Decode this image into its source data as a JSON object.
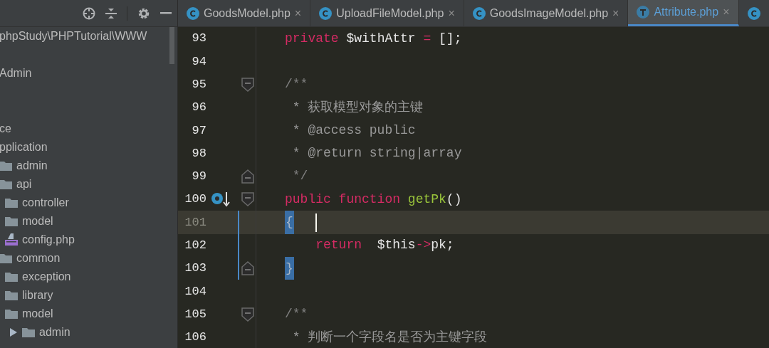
{
  "sidebar": {
    "tree": [
      {
        "name": "phpStudy\\PHPTutorial\\WWW"
      },
      {
        "name": "Admin"
      },
      {
        "name": "ce"
      },
      {
        "name": "pplication",
        "children": [
          {
            "name": "admin",
            "kind": "folder"
          },
          {
            "name": "api",
            "kind": "folder",
            "children": [
              {
                "name": "controller",
                "kind": "folder"
              },
              {
                "name": "model",
                "kind": "folder"
              },
              {
                "name": "config.php",
                "kind": "php"
              }
            ]
          },
          {
            "name": "common",
            "kind": "folder",
            "children": [
              {
                "name": "exception",
                "kind": "folder"
              },
              {
                "name": "library",
                "kind": "folder"
              },
              {
                "name": "model",
                "kind": "folder",
                "children": [
                  {
                    "name": "admin",
                    "kind": "folder",
                    "expanded": false
                  }
                ]
              }
            ]
          }
        ]
      }
    ]
  },
  "tabs": [
    {
      "label": "GoodsModel.php",
      "kind": "class",
      "close": "×",
      "selected": false
    },
    {
      "label": "UploadFileModel.php",
      "kind": "class",
      "close": "×",
      "selected": false
    },
    {
      "label": "GoodsImageModel.php",
      "kind": "class",
      "close": "×",
      "selected": false
    },
    {
      "label": "Attribute.php",
      "kind": "trait",
      "close": "×",
      "selected": true
    },
    {
      "kind": "class",
      "selected": false
    }
  ],
  "editor": {
    "lines": [
      {
        "number": "93",
        "current": false,
        "modified": false,
        "tokens": [
          {
            "kind": "keyword",
            "text": "private"
          },
          {
            "kind": "plain",
            "text": " $withAttr "
          },
          {
            "kind": "keyword",
            "text": "="
          },
          {
            "kind": "plain",
            "text": " [];"
          }
        ]
      },
      {
        "number": "94",
        "current": false,
        "modified": false
      },
      {
        "number": "95",
        "current": false,
        "modified": false,
        "fold": {
          "kind": "start"
        },
        "tokens": [
          {
            "kind": "comment",
            "text": "/**"
          }
        ]
      },
      {
        "number": "96",
        "current": false,
        "modified": false,
        "tokens": [
          {
            "kind": "doc",
            "text": " * 获取模型对象的主键"
          }
        ]
      },
      {
        "number": "97",
        "current": false,
        "modified": false,
        "tokens": [
          {
            "kind": "doc",
            "text": " * @access public"
          }
        ]
      },
      {
        "number": "98",
        "current": false,
        "modified": false,
        "tokens": [
          {
            "kind": "doc",
            "text": " * @return string|array"
          }
        ]
      },
      {
        "number": "99",
        "current": false,
        "modified": false,
        "fold": {
          "kind": "end"
        },
        "tokens": [
          {
            "kind": "comment",
            "text": " */"
          }
        ]
      },
      {
        "number": "100",
        "current": false,
        "modified": false,
        "fold": {
          "kind": "start"
        },
        "gutter_icon": {
          "kind": "override"
        },
        "tokens": [
          {
            "kind": "keyword",
            "text": "public function "
          },
          {
            "kind": "function",
            "text": "getPk"
          },
          {
            "kind": "plain",
            "text": "()"
          }
        ]
      },
      {
        "number": "101",
        "current": true,
        "modified": true,
        "caret": true,
        "tokens": [
          {
            "kind": "brace_match",
            "text": "{"
          }
        ]
      },
      {
        "number": "102",
        "current": false,
        "modified": true,
        "tokens": [
          {
            "kind": "keyword",
            "text": "    return"
          },
          {
            "kind": "plain",
            "text": "  $this"
          },
          {
            "kind": "keyword",
            "text": "->"
          },
          {
            "kind": "plain",
            "text": "pk;"
          }
        ]
      },
      {
        "number": "103",
        "current": false,
        "modified": true,
        "fold": {
          "kind": "end"
        },
        "tokens": [
          {
            "kind": "brace_match",
            "text": "}"
          }
        ]
      },
      {
        "number": "104",
        "current": false,
        "modified": false
      },
      {
        "number": "105",
        "current": false,
        "modified": false,
        "fold": {
          "kind": "start"
        },
        "tokens": [
          {
            "kind": "comment",
            "text": "/**"
          }
        ]
      },
      {
        "number": "106",
        "current": false,
        "modified": false,
        "tokens": [
          {
            "kind": "doc",
            "text": " * 判断一个字段名是否为主键字段"
          }
        ]
      }
    ]
  }
}
